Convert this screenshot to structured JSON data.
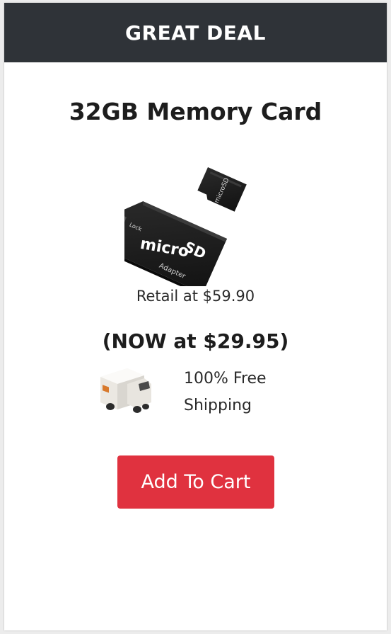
{
  "banner": {
    "title": "GREAT DEAL"
  },
  "product": {
    "title": "32GB Memory Card",
    "retail_text": "Retail at $59.90",
    "sale_text": "(NOW at $29.95)",
    "image_icon": "microsd-card-with-adapter-image"
  },
  "shipping": {
    "line1": "100% Free",
    "line2": "Shipping",
    "icon": "delivery-truck-icon"
  },
  "cta": {
    "label": "Add To Cart"
  },
  "colors": {
    "banner_bg": "#2f3338",
    "button_bg": "#e0323f",
    "text": "#1d1d1d"
  }
}
